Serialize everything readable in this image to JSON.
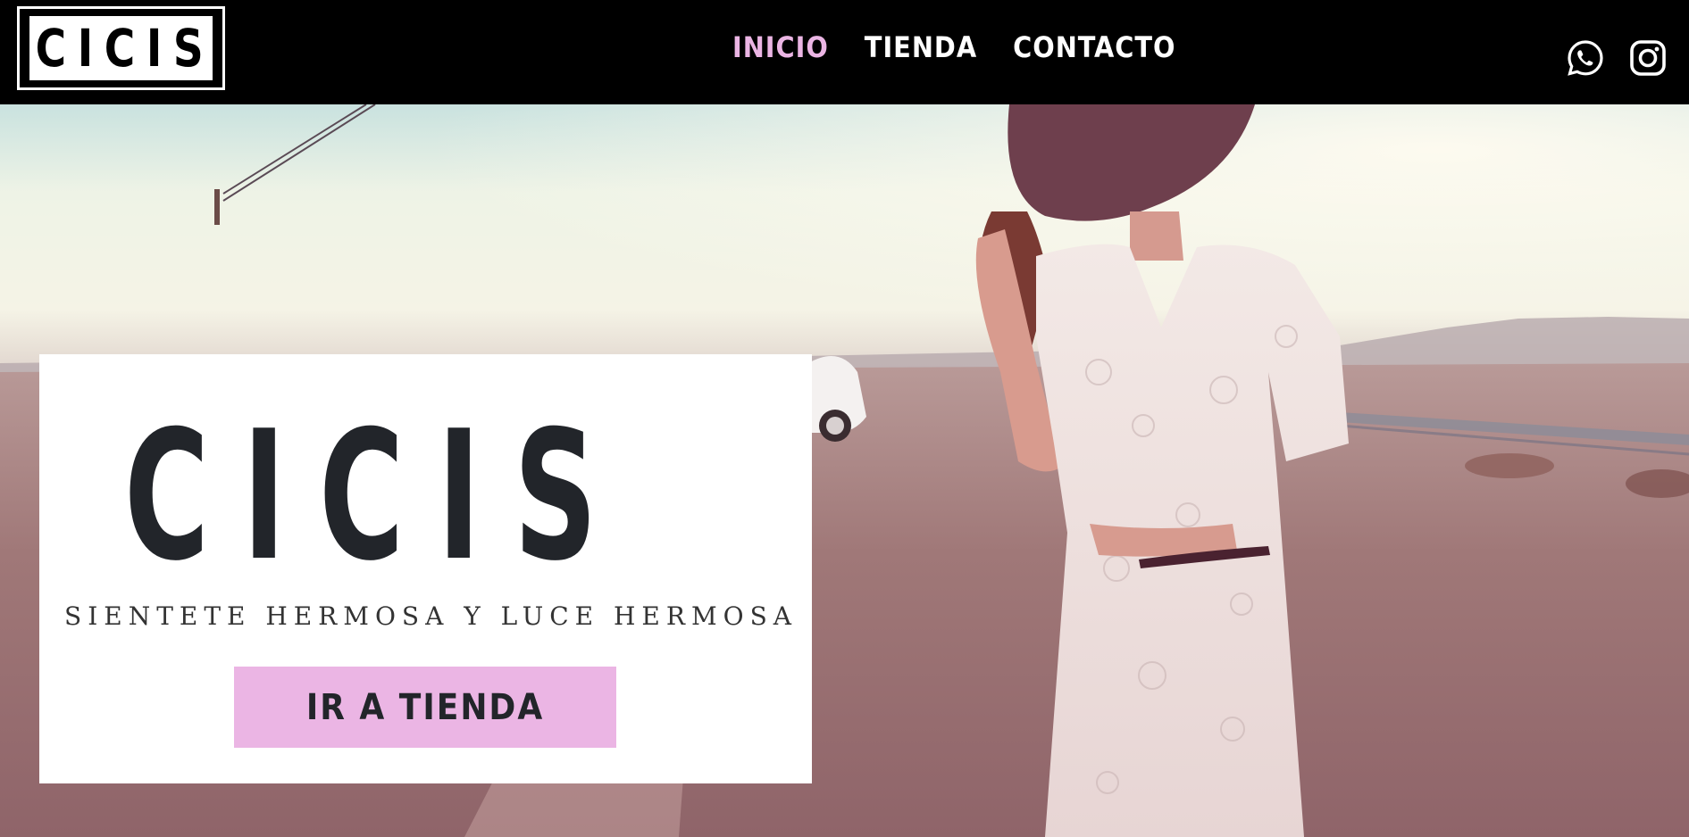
{
  "header": {
    "logo_text": "CICIS",
    "nav": [
      {
        "label": "INICIO",
        "active": true
      },
      {
        "label": "TIENDA",
        "active": false
      },
      {
        "label": "CONTACTO",
        "active": false
      }
    ],
    "social_icons": [
      "whatsapp-icon",
      "instagram-icon"
    ]
  },
  "hero": {
    "title": "CICIS",
    "subtitle": "SIENTETE HERMOSA Y LUCE HERMOSA",
    "button_label": "IR A TIENDA",
    "image": "woman-in-lace-dress-desert-photo"
  },
  "colors": {
    "accent": "#ebb5e4",
    "header_bg": "#000000",
    "text_dark": "#22252a"
  }
}
